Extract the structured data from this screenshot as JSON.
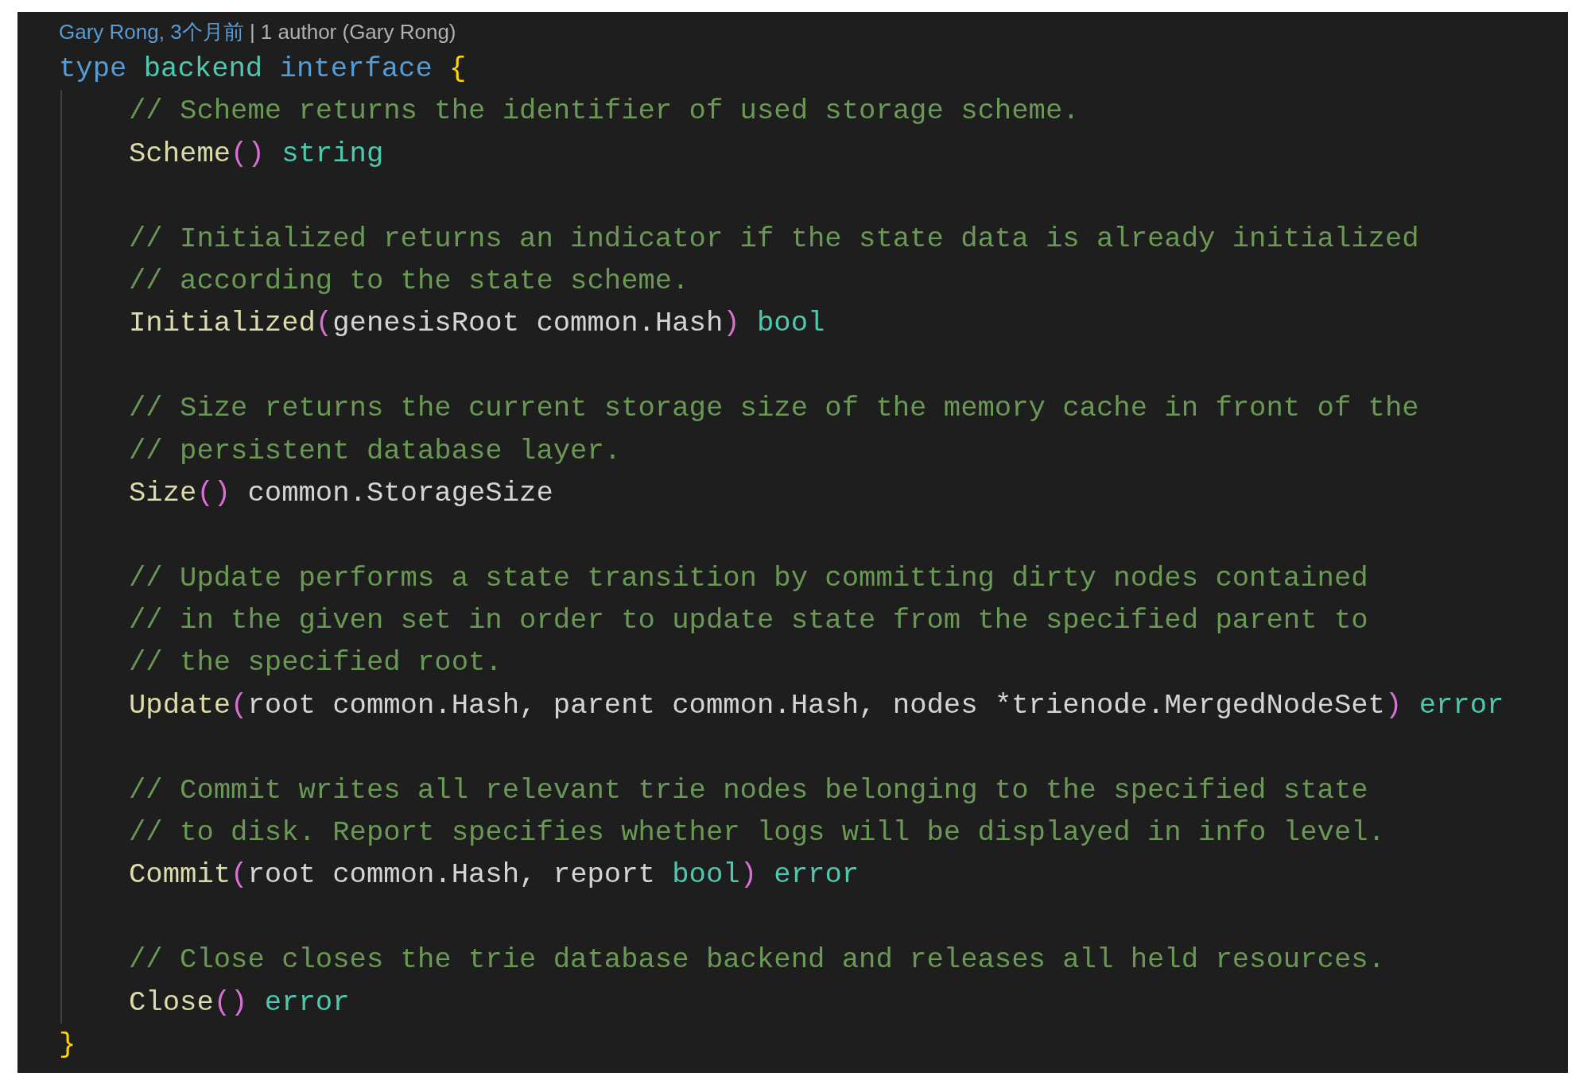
{
  "blame": {
    "author": "Gary Rong, 3个月前",
    "summary": "| 1 author (Gary Rong)"
  },
  "lines": [
    {
      "kind": "code",
      "tokens": [
        {
          "kind": "keyword",
          "text": "type "
        },
        {
          "kind": "type",
          "text": "backend "
        },
        {
          "kind": "keyword",
          "text": "interface "
        },
        {
          "kind": "brace",
          "text": "{"
        }
      ],
      "children": [
        {
          "kind": "code",
          "tokens": [
            {
              "kind": "comment",
              "text": "// Scheme returns the identifier of used storage scheme."
            }
          ]
        },
        {
          "kind": "code",
          "tokens": [
            {
              "kind": "function",
              "text": "Scheme"
            },
            {
              "kind": "paren",
              "text": "()"
            },
            {
              "kind": "type",
              "text": " string"
            }
          ]
        },
        {
          "kind": "blank"
        },
        {
          "kind": "code",
          "tokens": [
            {
              "kind": "comment",
              "text": "// Initialized returns an indicator if the state data is already initialized"
            }
          ]
        },
        {
          "kind": "code",
          "tokens": [
            {
              "kind": "comment",
              "text": "// according to the state scheme."
            }
          ]
        },
        {
          "kind": "code",
          "tokens": [
            {
              "kind": "function",
              "text": "Initialized"
            },
            {
              "kind": "paren",
              "text": "("
            },
            {
              "kind": "plain",
              "text": "genesisRoot common.Hash"
            },
            {
              "kind": "paren",
              "text": ")"
            },
            {
              "kind": "type",
              "text": " bool"
            }
          ]
        },
        {
          "kind": "blank"
        },
        {
          "kind": "code",
          "tokens": [
            {
              "kind": "comment",
              "text": "// Size returns the current storage size of the memory cache in front of the"
            }
          ]
        },
        {
          "kind": "code",
          "tokens": [
            {
              "kind": "comment",
              "text": "// persistent database layer."
            }
          ]
        },
        {
          "kind": "code",
          "tokens": [
            {
              "kind": "function",
              "text": "Size"
            },
            {
              "kind": "paren",
              "text": "()"
            },
            {
              "kind": "plain",
              "text": " common.StorageSize"
            }
          ]
        },
        {
          "kind": "blank"
        },
        {
          "kind": "code",
          "tokens": [
            {
              "kind": "comment",
              "text": "// Update performs a state transition by committing dirty nodes contained"
            }
          ]
        },
        {
          "kind": "code",
          "tokens": [
            {
              "kind": "comment",
              "text": "// in the given set in order to update state from the specified parent to"
            }
          ]
        },
        {
          "kind": "code",
          "tokens": [
            {
              "kind": "comment",
              "text": "// the specified root."
            }
          ]
        },
        {
          "kind": "code",
          "tokens": [
            {
              "kind": "function",
              "text": "Update"
            },
            {
              "kind": "paren",
              "text": "("
            },
            {
              "kind": "plain",
              "text": "root common.Hash, parent common.Hash, nodes *trienode.MergedNodeSet"
            },
            {
              "kind": "paren",
              "text": ")"
            },
            {
              "kind": "type",
              "text": " error"
            }
          ]
        },
        {
          "kind": "blank"
        },
        {
          "kind": "code",
          "tokens": [
            {
              "kind": "comment",
              "text": "// Commit writes all relevant trie nodes belonging to the specified state"
            }
          ]
        },
        {
          "kind": "code",
          "tokens": [
            {
              "kind": "comment",
              "text": "// to disk. Report specifies whether logs will be displayed in info level."
            }
          ]
        },
        {
          "kind": "code",
          "tokens": [
            {
              "kind": "function",
              "text": "Commit"
            },
            {
              "kind": "paren",
              "text": "("
            },
            {
              "kind": "plain",
              "text": "root common.Hash, report "
            },
            {
              "kind": "type",
              "text": "bool"
            },
            {
              "kind": "paren",
              "text": ")"
            },
            {
              "kind": "type",
              "text": " error"
            }
          ]
        },
        {
          "kind": "blank"
        },
        {
          "kind": "code",
          "tokens": [
            {
              "kind": "comment",
              "text": "// Close closes the trie database backend and releases all held resources."
            }
          ]
        },
        {
          "kind": "code",
          "tokens": [
            {
              "kind": "function",
              "text": "Close"
            },
            {
              "kind": "paren",
              "text": "()"
            },
            {
              "kind": "type",
              "text": " error"
            }
          ]
        }
      ]
    },
    {
      "kind": "code",
      "tokens": [
        {
          "kind": "brace",
          "text": "}"
        }
      ]
    }
  ]
}
